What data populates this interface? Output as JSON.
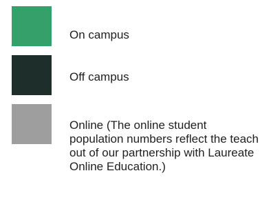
{
  "chart_data": {
    "type": "table",
    "legend": [
      {
        "label": "On campus",
        "color": "#36A06B"
      },
      {
        "label": "Off campus",
        "color": "#1E2E2B"
      },
      {
        "label": "Online (The online student population numbers reflect the teach out of our partnership with Laureate Online Education.)",
        "color": "#9E9E9E"
      }
    ]
  }
}
